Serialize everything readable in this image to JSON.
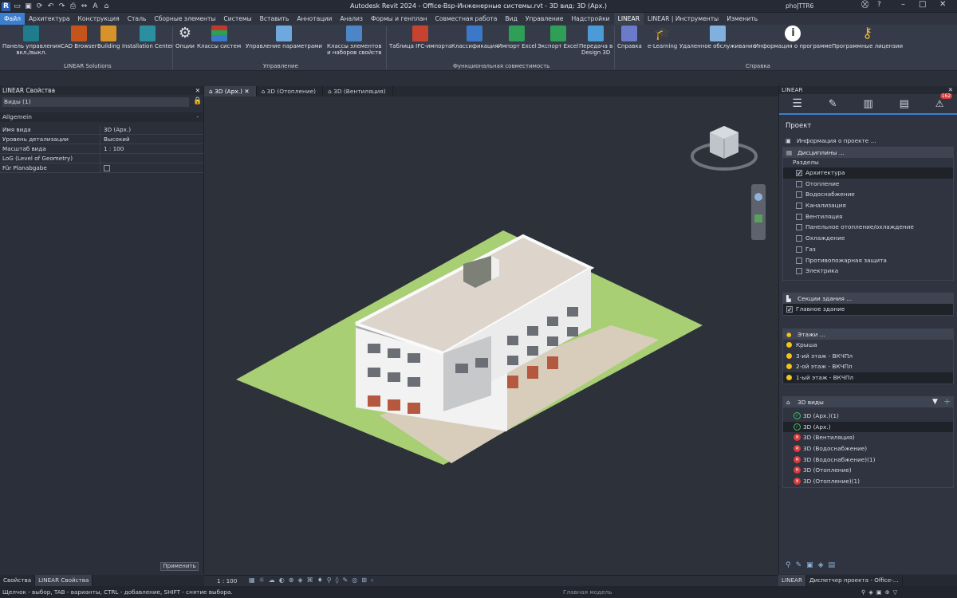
{
  "title": "Autodesk Revit 2024 - Office-Bsp-Инженерные системы.rvt - 3D вид: 3D (Арх.)",
  "user": "phoJTTR6",
  "menu": [
    "Файл",
    "Архитектура",
    "Конструкция",
    "Сталь",
    "Сборные элементы",
    "Системы",
    "Вставить",
    "Аннотации",
    "Анализ",
    "Формы и генплан",
    "Совместная работа",
    "Вид",
    "Управление",
    "Надстройки",
    "LINEAR",
    "LINEAR | Инструменты",
    "Изменить"
  ],
  "ribbon": {
    "buttons": [
      {
        "label1": "Панель управления",
        "label2": "вкл./выкл.",
        "color": "#1e7c8c"
      },
      {
        "label1": "CAD Browser",
        "label2": "",
        "color": "#c4541b"
      },
      {
        "label1": "Building",
        "label2": "",
        "color": "#d8922a"
      },
      {
        "label1": "Installation Center",
        "label2": "",
        "color": "#2b8fa0"
      },
      {
        "label1": "Опции",
        "label2": "",
        "color": "#dfe3ea"
      },
      {
        "label1": "Классы систем",
        "label2": "",
        "color": "#c0392b"
      },
      {
        "label1": "Управление параметрами",
        "label2": "",
        "color": "#6fa8dc"
      },
      {
        "label1": "Классы элементов",
        "label2": "и наборов свойств",
        "color": "#4d86c6"
      },
      {
        "label1": "Таблица IFC-импорта",
        "label2": "",
        "color": "#c8432f"
      },
      {
        "label1": "Классификация",
        "label2": "",
        "color": "#3c78c8"
      },
      {
        "label1": "Импорт Excel",
        "label2": "",
        "color": "#2f9e57"
      },
      {
        "label1": "Экспорт Excel",
        "label2": "",
        "color": "#2f9e57"
      },
      {
        "label1": "Передача в",
        "label2": "Design 3D",
        "color": "#4b9bd6"
      },
      {
        "label1": "Справка",
        "label2": "",
        "color": "#6b7ac9"
      },
      {
        "label1": "e-Learning",
        "label2": "",
        "color": "#e6e9ef"
      },
      {
        "label1": "Удаленное обслуживание",
        "label2": "",
        "color": "#7fb0de"
      },
      {
        "label1": "Информация о программе",
        "label2": "",
        "color": "#ffffff"
      },
      {
        "label1": "Программные лицензии",
        "label2": "",
        "color": "#e6b53a"
      }
    ],
    "groups": [
      "LINEAR Solutions",
      "Управление",
      "Функциональная совместимость",
      "Справка"
    ]
  },
  "properties": {
    "header": "LINEAR Свойства",
    "type_selector": "Виды (1)",
    "section": "Allgemein",
    "rows": [
      {
        "k": "Имя вида",
        "v": "3D (Арх.)"
      },
      {
        "k": "Уровень детализации",
        "v": "Высокий"
      },
      {
        "k": "Масштаб вида",
        "v": "1 : 100"
      },
      {
        "k": "LoG (Level of Geometry)",
        "v": ""
      },
      {
        "k": "Für Planabgabe",
        "v": ""
      }
    ],
    "apply": "Применить",
    "tabs": [
      "Свойства",
      "LINEAR Свойства"
    ]
  },
  "doctabs": [
    "3D (Арх.)",
    "3D (Отопление)",
    "3D (Вентиляция)"
  ],
  "view_scale": "1 : 100",
  "model_status": "Главная модель",
  "linear": {
    "header": "LINEAR",
    "section_title": "Проект",
    "project_info": "Информация о проекте ...",
    "disciplines_hdr": "Дисциплины ...",
    "sections_label": "Разделы",
    "disciplines": [
      {
        "name": "Архитектура",
        "checked": true
      },
      {
        "name": "Отопление",
        "checked": false
      },
      {
        "name": "Водоснабжение",
        "checked": false
      },
      {
        "name": "Канализация",
        "checked": false
      },
      {
        "name": "Вентиляция",
        "checked": false
      },
      {
        "name": "Панельное отопление/охлаждение",
        "checked": false
      },
      {
        "name": "Охлаждение",
        "checked": false
      },
      {
        "name": "Газ",
        "checked": false
      },
      {
        "name": "Противопожарная защита",
        "checked": false
      },
      {
        "name": "Электрика",
        "checked": false
      }
    ],
    "building_sections_hdr": "Секции здания ...",
    "building_sections": [
      "Главное здание"
    ],
    "floors_hdr": "Этажи ...",
    "floors": [
      "Крыша",
      "3-ий этаж - ВКЧПл",
      "2-ой этаж - ВКЧПл",
      "1-ый этаж - ВКЧПл"
    ],
    "views_hdr": "3D виды",
    "views": [
      {
        "name": "3D (Арх.)(1)",
        "ok": true
      },
      {
        "name": "3D (Арх.)",
        "ok": true
      },
      {
        "name": "3D (Вентиляция)",
        "ok": false
      },
      {
        "name": "3D (Водоснабжение)",
        "ok": false
      },
      {
        "name": "3D (Водоснабжение)(1)",
        "ok": false
      },
      {
        "name": "3D (Отопление)",
        "ok": false
      },
      {
        "name": "3D (Отопление)(1)",
        "ok": false
      }
    ],
    "badge": "162",
    "bottom_tabs": [
      "LINEAR",
      "Диспетчер проекта - Office-..."
    ]
  },
  "status": "Щелчок - выбор, TAB - варианты, CTRL - добавление, SHIFT - снятие выбора."
}
